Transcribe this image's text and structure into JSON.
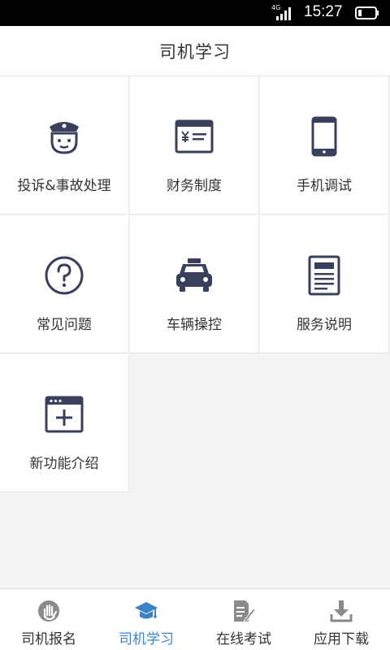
{
  "status_bar": {
    "network": "4G",
    "time": "15:27"
  },
  "header": {
    "title": "司机学习"
  },
  "grid": {
    "items": [
      {
        "label": "投诉&事故处理",
        "icon": "police-icon"
      },
      {
        "label": "财务制度",
        "icon": "finance-icon"
      },
      {
        "label": "手机调试",
        "icon": "phone-icon"
      },
      {
        "label": "常见问题",
        "icon": "question-icon"
      },
      {
        "label": "车辆操控",
        "icon": "taxi-icon"
      },
      {
        "label": "服务说明",
        "icon": "document-icon"
      },
      {
        "label": "新功能介绍",
        "icon": "new-feature-icon"
      }
    ]
  },
  "tabs": {
    "active_color": "#3a83c4",
    "items": [
      {
        "label": "司机报名",
        "icon": "hand-icon",
        "active": false
      },
      {
        "label": "司机学习",
        "icon": "graduation-cap-icon",
        "active": true
      },
      {
        "label": "在线考试",
        "icon": "exam-icon",
        "active": false
      },
      {
        "label": "应用下载",
        "icon": "download-icon",
        "active": false
      }
    ]
  },
  "colors": {
    "icon": "#3a3f5c",
    "background": "#f4f4f4"
  }
}
